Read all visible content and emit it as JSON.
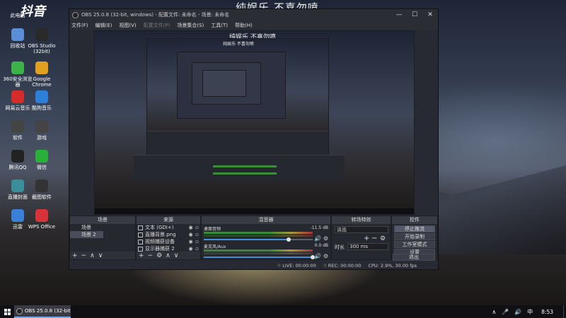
{
  "desktop": {
    "banner": "纯娱乐 不喜勿喷",
    "logo": "抖音",
    "icons": [
      {
        "label": "此电脑",
        "icon": "computer-icon",
        "color": "#4a7fd0"
      },
      {
        "label": "回收站",
        "icon": "recycle-bin-icon",
        "color": "#5a8fd8"
      },
      {
        "label": "OBS Studio (32bit)",
        "icon": "obs-icon",
        "color": "#2a2a2a"
      },
      {
        "label": "360安全浏览器",
        "icon": "360-browser-icon",
        "color": "#3bb34a"
      },
      {
        "label": "Google Chrome",
        "icon": "chrome-icon",
        "color": "#e0a020"
      },
      {
        "label": "网易云音乐",
        "icon": "netease-music-icon",
        "color": "#d52b2b"
      },
      {
        "label": "酷狗音乐",
        "icon": "kugou-icon",
        "color": "#2d7fd8"
      },
      {
        "label": "软件",
        "icon": "folder-icon",
        "color": "#444"
      },
      {
        "label": "游戏",
        "icon": "gamepad-icon",
        "color": "#444"
      },
      {
        "label": "腾讯QQ",
        "icon": "qq-icon",
        "color": "#222"
      },
      {
        "label": "微信",
        "icon": "wechat-icon",
        "color": "#2aae3c"
      },
      {
        "label": "直播封面",
        "icon": "image-icon",
        "color": "#3a8f9a"
      },
      {
        "label": "截图软件",
        "icon": "screenshot-icon",
        "color": "#333"
      },
      {
        "label": "迅雷",
        "icon": "xunlei-icon",
        "color": "#3a7fd8"
      },
      {
        "label": "WPS Office",
        "icon": "wps-icon",
        "color": "#d8333a"
      }
    ]
  },
  "obs": {
    "title": "OBS 25.0.8 (32-bit, windows) - 配置文件: 未命名 - 场景: 未命名",
    "window_controls": [
      "—",
      "☐",
      "✕"
    ],
    "menu": [
      {
        "label": "文件(F)",
        "disabled": false
      },
      {
        "label": "编辑(E)",
        "disabled": false
      },
      {
        "label": "视图(V)",
        "disabled": false
      },
      {
        "label": "配置文件(P)",
        "disabled": true
      },
      {
        "label": "场景集合(S)",
        "disabled": false
      },
      {
        "label": "工具(T)",
        "disabled": false
      },
      {
        "label": "帮助(H)",
        "disabled": false
      }
    ],
    "preview_banner": "纯娱乐 不喜勿喷",
    "docks": {
      "scenes": {
        "title": "场景",
        "items": [
          "场景",
          "场景 2"
        ],
        "selected": 1
      },
      "sources": {
        "title": "来源",
        "items": [
          "文本 (GDI+)",
          "直播背景.png",
          "视频捕获设备",
          "显示器捕获 2"
        ]
      },
      "mixer": {
        "title": "混音器",
        "tracks": [
          {
            "name": "桌面音频",
            "db": "-11.5 dB",
            "level": 0.78
          },
          {
            "name": "麦克风/Aux",
            "db": "0.0 dB",
            "level": 1.0
          }
        ]
      },
      "transitions": {
        "title": "转场特效",
        "type": "淡出",
        "duration_label": "时长",
        "duration": "300 ms"
      },
      "controls": {
        "title": "控件",
        "buttons": [
          "停止推流",
          "开始录制",
          "工作室模式",
          "设置",
          "退出"
        ]
      }
    },
    "dock_footer_icons": [
      "+",
      "−",
      "∧",
      "∨"
    ],
    "status": {
      "live": "LIVE: 00:00:00",
      "rec": "REC: 00:00:00",
      "cpu": "CPU: 2.9%, 30.00 fps"
    }
  },
  "taskbar": {
    "task_label": "OBS 25.0.8 (32-bit, ...",
    "tray": [
      "∧",
      "🎤",
      "🔊",
      "中"
    ],
    "clock": "8:53"
  }
}
